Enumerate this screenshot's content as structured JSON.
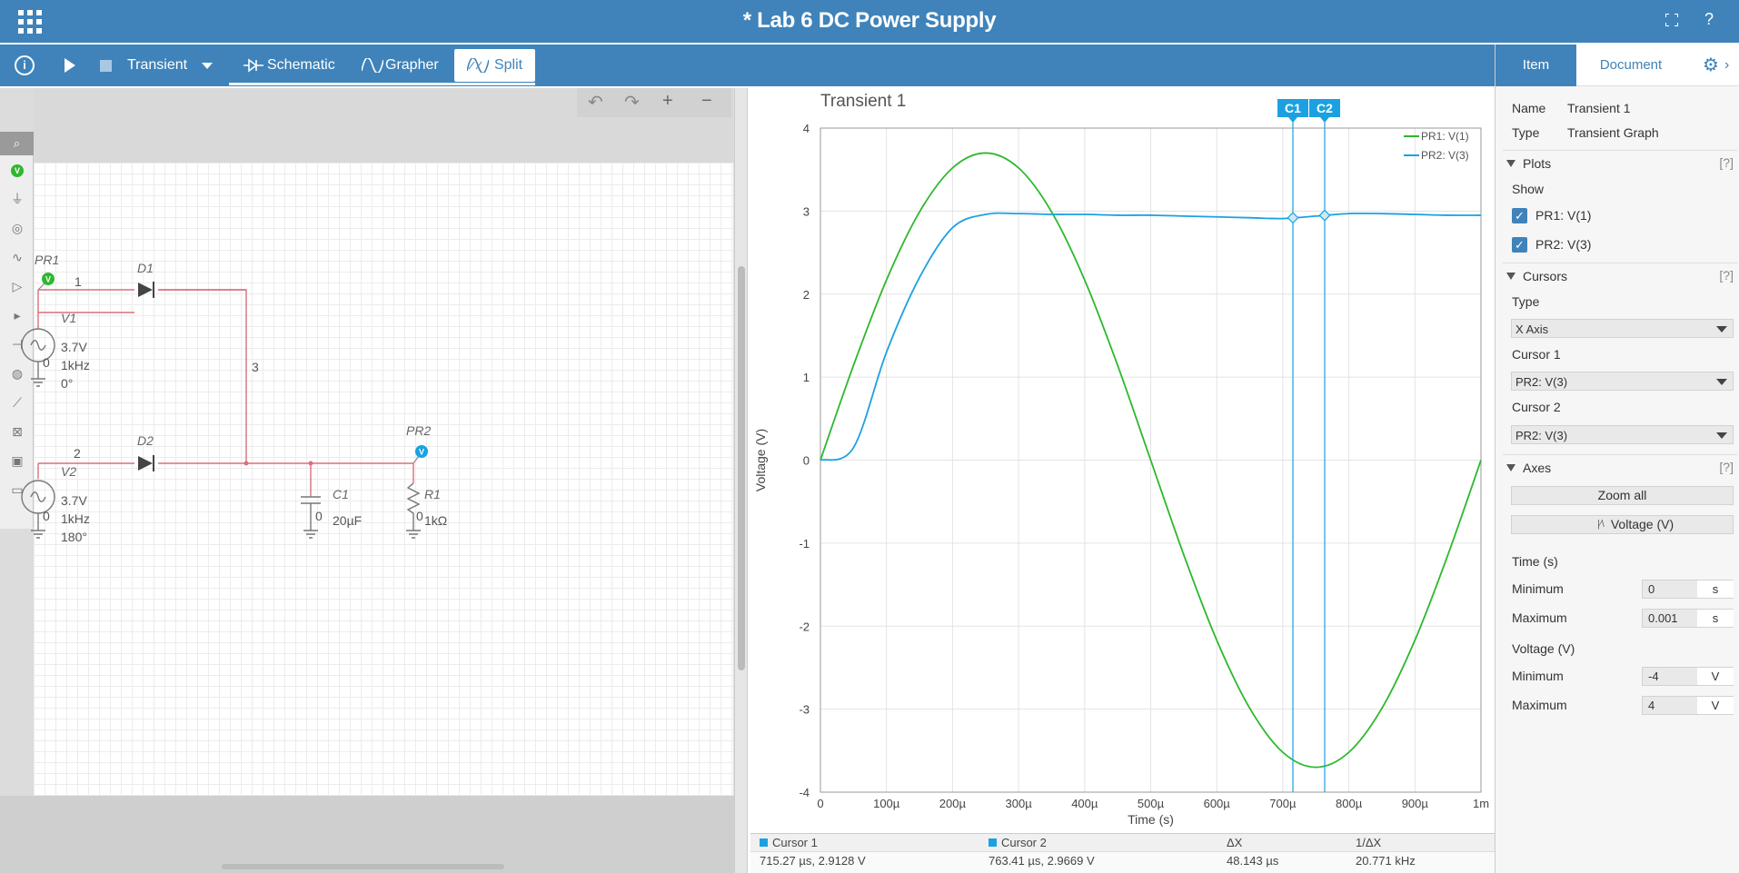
{
  "app": {
    "title": "* Lab 6 DC Power Supply"
  },
  "toolbar": {
    "analysis": "Transient",
    "tab_schematic": "Schematic",
    "tab_grapher": "Grapher",
    "tab_split": "Split"
  },
  "schematic": {
    "probes": [
      {
        "name": "PR1"
      },
      {
        "name": "PR2"
      }
    ],
    "components": [
      {
        "name": "D1",
        "kind": "diode"
      },
      {
        "name": "D2",
        "kind": "diode"
      },
      {
        "name": "V1",
        "kind": "ac-source",
        "amplitude": "3.7V",
        "freq": "1kHz",
        "phase": "0°"
      },
      {
        "name": "V2",
        "kind": "ac-source",
        "amplitude": "3.7V",
        "freq": "1kHz",
        "phase": "180°"
      },
      {
        "name": "C1",
        "kind": "capacitor",
        "value": "20µF"
      },
      {
        "name": "R1",
        "kind": "resistor",
        "value": "1kΩ"
      }
    ],
    "node_labels": [
      "1",
      "2",
      "3"
    ],
    "ground_labels": [
      "0",
      "0",
      "0",
      "0"
    ]
  },
  "grapher": {
    "title": "Transient 1",
    "cursor_labels": [
      "C1",
      "C2"
    ],
    "legend": [
      "PR1: V(1)",
      "PR2: V(3)"
    ]
  },
  "chart_data": {
    "type": "line",
    "title": "Transient 1",
    "xlabel": "Time (s)",
    "ylabel": "Voltage (V)",
    "xlim": [
      0,
      0.001
    ],
    "ylim": [
      -4,
      4
    ],
    "x_ticks": [
      "0",
      "100µ",
      "200µ",
      "300µ",
      "400µ",
      "500µ",
      "600µ",
      "700µ",
      "800µ",
      "900µ",
      "1m"
    ],
    "y_ticks": [
      "4",
      "3",
      "2",
      "1",
      "0",
      "-1",
      "-2",
      "-3",
      "-4"
    ],
    "grid": true,
    "legend_position": "top-right",
    "x": [
      0,
      5e-05,
      0.0001,
      0.00015,
      0.0002,
      0.00025,
      0.0003,
      0.00035,
      0.0004,
      0.00045,
      0.0005,
      0.00055,
      0.0006,
      0.00065,
      0.0007,
      0.00075,
      0.0008,
      0.00085,
      0.0009,
      0.00095,
      0.001
    ],
    "series": [
      {
        "name": "PR1: V(1)",
        "color": "#2eb82e",
        "values": [
          0,
          1.14,
          2.17,
          2.99,
          3.52,
          3.7,
          3.52,
          2.99,
          2.17,
          1.14,
          0,
          -1.14,
          -2.17,
          -2.99,
          -3.52,
          -3.7,
          -3.52,
          -2.99,
          -2.17,
          -1.14,
          0
        ]
      },
      {
        "name": "PR2: V(3)",
        "color": "#1ba1e2",
        "values": [
          0,
          0.15,
          1.3,
          2.2,
          2.8,
          2.96,
          2.97,
          2.96,
          2.96,
          2.95,
          2.95,
          2.94,
          2.93,
          2.92,
          2.91,
          2.94,
          2.97,
          2.97,
          2.96,
          2.95,
          2.95
        ]
      }
    ],
    "cursors": [
      {
        "name": "C1",
        "x": 0.00071527
      },
      {
        "name": "C2",
        "x": 0.00076341
      }
    ]
  },
  "cursor_table": {
    "headers": [
      "Cursor 1",
      "Cursor 2",
      "ΔX",
      "1/ΔX"
    ],
    "values": [
      "715.27 µs, 2.9128 V",
      "763.41 µs, 2.9669 V",
      "48.143 µs",
      "20.771 kHz"
    ],
    "swatch_color": "#1ba1e2"
  },
  "panel": {
    "tab_item": "Item",
    "tab_document": "Document",
    "name_label": "Name",
    "name_value": "Transient 1",
    "type_label": "Type",
    "type_value": "Transient Graph",
    "plots_title": "Plots",
    "help": "[?]",
    "show_label": "Show",
    "plots": [
      "PR1: V(1)",
      "PR2: V(3)"
    ],
    "cursors_title": "Cursors",
    "cursor_type_label": "Type",
    "cursor_type_value": "X Axis",
    "cursor1_label": "Cursor 1",
    "cursor1_value": "PR2: V(3)",
    "cursor2_label": "Cursor 2",
    "cursor2_value": "PR2: V(3)",
    "axes_title": "Axes",
    "zoom_all": "Zoom all",
    "voltage_btn": "Voltage (V)",
    "time_title": "Time (s)",
    "time_min_label": "Minimum",
    "time_min_value": "0",
    "time_min_unit": "s",
    "time_max_label": "Maximum",
    "time_max_value": "0.001",
    "time_max_unit": "s",
    "volt_title": "Voltage (V)",
    "volt_min_label": "Minimum",
    "volt_min_value": "-4",
    "volt_min_unit": "V",
    "volt_max_label": "Maximum",
    "volt_max_value": "4",
    "volt_max_unit": "V"
  }
}
